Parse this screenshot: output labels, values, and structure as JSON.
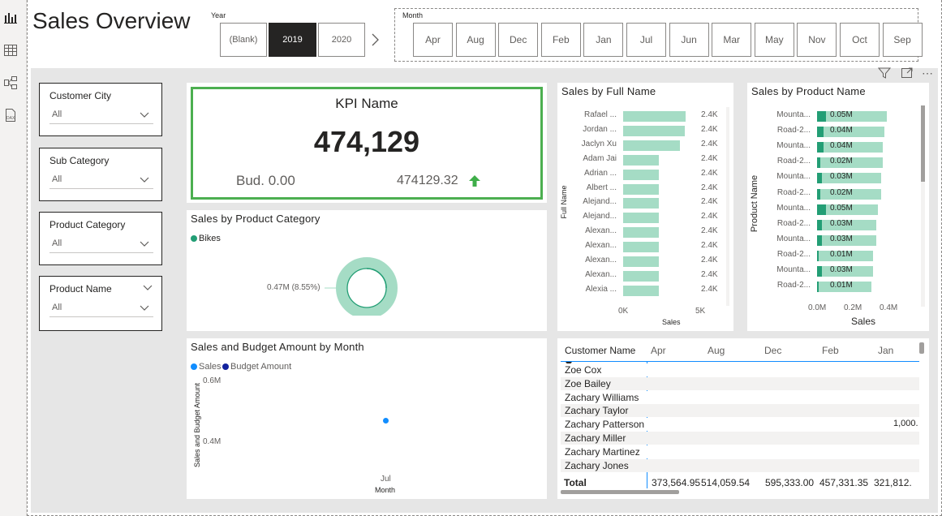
{
  "page": {
    "title": "Sales Overview"
  },
  "year_slicer": {
    "label": "Year",
    "options": [
      "(Blank)",
      "2019",
      "2020"
    ],
    "selected": "2019"
  },
  "month_slicer": {
    "label": "Month",
    "options": [
      "Apr",
      "Aug",
      "Dec",
      "Feb",
      "Jan",
      "Jul",
      "Jun",
      "Mar",
      "May",
      "Nov",
      "Oct",
      "Sep"
    ]
  },
  "slicers": [
    {
      "title": "Customer City",
      "value": "All"
    },
    {
      "title": "Sub Category",
      "value": "All"
    },
    {
      "title": "Product Category",
      "value": "All"
    },
    {
      "title": "Product Name",
      "value": "All"
    }
  ],
  "kpi": {
    "title": "KPI Name",
    "value": "474,129",
    "budget": "Bud. 0.00",
    "actual": "474129.32",
    "accent": "#4caf50",
    "arrow_color": "#3fae49"
  },
  "donut": {
    "title": "Sales by Product Category",
    "legend": "Bikes",
    "label": "0.47M (8.55%)",
    "color": "#a5dcc5",
    "accent": "#239e75"
  },
  "full_name_chart": {
    "title": "Sales by Full Name",
    "ylabel": "Full Name",
    "xlabel": "Sales",
    "ticks": [
      "0K",
      "5K"
    ],
    "names": [
      "Rafael ...",
      "Jordan ...",
      "Jaclyn Xu",
      "Adam Jai",
      "Adrian ...",
      "Albert ...",
      "Alejand...",
      "Alejand...",
      "Alexan...",
      "Alexan...",
      "Alexan...",
      "Alexan...",
      "Alexia ..."
    ],
    "values": [
      2.4,
      2.4,
      2.4,
      2.4,
      2.4,
      2.4,
      2.4,
      2.4,
      2.4,
      2.4,
      2.4,
      2.4,
      2.4
    ],
    "labels": [
      "2.4K",
      "2.4K",
      "2.4K",
      "2.4K",
      "2.4K",
      "2.4K",
      "2.4K",
      "2.4K",
      "2.4K",
      "2.4K",
      "2.4K",
      "2.4K",
      "2.4K"
    ],
    "fill": [
      0.88,
      0.86,
      0.8,
      0.5,
      0.5,
      0.5,
      0.5,
      0.5,
      0.5,
      0.5,
      0.5,
      0.5,
      0.5
    ]
  },
  "product_name_chart": {
    "title": "Sales by Product Name",
    "ylabel": "Product Name",
    "xlabel": "Sales",
    "ticks": [
      "0.0M",
      "0.2M",
      "0.4M"
    ],
    "names": [
      "Mounta...",
      "Road-2...",
      "Mounta...",
      "Road-2...",
      "Mounta...",
      "Road-2...",
      "Mounta...",
      "Road-2...",
      "Mounta...",
      "Road-2...",
      "Mounta...",
      "Road-2..."
    ],
    "labels": [
      "0.05M",
      "0.04M",
      "0.04M",
      "0.02M",
      "0.03M",
      "0.02M",
      "0.05M",
      "0.03M",
      "0.03M",
      "0.01M",
      "0.03M",
      "0.01M"
    ],
    "fill": [
      0.9,
      0.86,
      0.84,
      0.84,
      0.82,
      0.82,
      0.78,
      0.76,
      0.76,
      0.72,
      0.72,
      0.7
    ],
    "dark": [
      0.11,
      0.08,
      0.08,
      0.04,
      0.06,
      0.04,
      0.11,
      0.06,
      0.06,
      0.02,
      0.06,
      0.02
    ]
  },
  "line_chart": {
    "title": "Sales and Budget Amount by Month",
    "legend": [
      "Sales",
      "Budget Amount"
    ],
    "colors": [
      "#118dff",
      "#12239e"
    ],
    "ylabel": "Sales and Budget Amount",
    "yticks": [
      "0.6M",
      "0.4M"
    ],
    "xtick": "Jul",
    "xlabel": "Month",
    "point_value": 0.47
  },
  "table": {
    "header": [
      "Customer Name",
      "Apr",
      "Aug",
      "Dec",
      "Feb",
      "Jan"
    ],
    "rows": [
      "Zoe Cox",
      "Zoe Bailey",
      "Zachary Williams",
      "Zachary Taylor",
      "Zachary Patterson",
      "Zachary Miller",
      "Zachary Martinez",
      "Zachary Jones"
    ],
    "jan_value": "1,000.",
    "total_label": "Total",
    "totals": [
      "373,564.95",
      "514,059.54",
      "595,333.00",
      "457,331.35",
      "321,812."
    ]
  }
}
